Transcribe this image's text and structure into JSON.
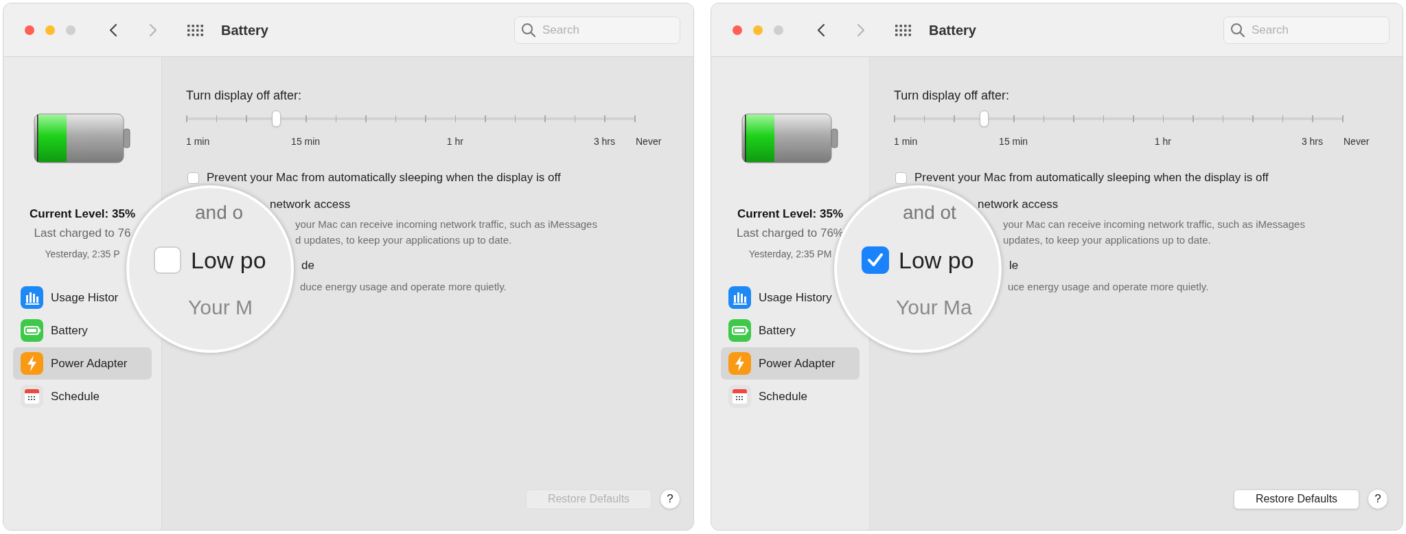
{
  "panels": [
    {
      "window": {
        "title": "Battery"
      },
      "search": {
        "placeholder": "Search"
      },
      "sidebar": {
        "current_level": "Current Level: 35%",
        "last_charged": "Last charged to 76",
        "last_charged_time": "Yesterday, 2:35 P",
        "items": [
          {
            "label": "Usage Histor",
            "kind": "usage",
            "selected": false
          },
          {
            "label": "Battery",
            "kind": "battery",
            "selected": false
          },
          {
            "label": "Power Adapter",
            "kind": "power",
            "selected": true
          },
          {
            "label": "Schedule",
            "kind": "schedule",
            "selected": false
          }
        ]
      },
      "display_off": {
        "label": "Turn display off after:",
        "slider": {
          "level": 0.2,
          "labels": [
            "1 min",
            "15 min",
            "1 hr",
            "3 hrs",
            "Never"
          ]
        }
      },
      "prevent_sleep": {
        "checked": false,
        "label": "Prevent your Mac from automatically sleeping when the display is off"
      },
      "network_fragment": "network access",
      "network_desc": [
        "your Mac can receive incoming network traffic, such as iMessages",
        "d updates, to keep your applications up to date."
      ],
      "low_power_fragment": "de",
      "low_power_desc_fragment": "duce energy usage and operate more quietly.",
      "magnifier": {
        "line_1": "and o",
        "checkbox": {
          "checked": false
        },
        "label": "Low po",
        "line_3": "Your M"
      },
      "restore_defaults": {
        "label": "Restore Defaults",
        "disabled": true
      },
      "help_button": "?"
    },
    {
      "window": {
        "title": "Battery"
      },
      "search": {
        "placeholder": "Search"
      },
      "sidebar": {
        "current_level": "Current Level: 35%",
        "last_charged": "Last charged to 76%",
        "last_charged_time": "Yesterday, 2:35 PM",
        "items": [
          {
            "label": "Usage History",
            "kind": "usage",
            "selected": false
          },
          {
            "label": "Battery",
            "kind": "battery",
            "selected": false
          },
          {
            "label": "Power Adapter",
            "kind": "power",
            "selected": true
          },
          {
            "label": "Schedule",
            "kind": "schedule",
            "selected": false
          }
        ]
      },
      "display_off": {
        "label": "Turn display off after:",
        "slider": {
          "level": 0.2,
          "labels": [
            "1 min",
            "15 min",
            "1 hr",
            "3 hrs",
            "Never"
          ]
        }
      },
      "prevent_sleep": {
        "checked": false,
        "label": "Prevent your Mac from automatically sleeping when the display is off"
      },
      "network_fragment": "network access",
      "network_desc": [
        "your Mac can receive incoming network traffic, such as iMessages",
        "updates, to keep your applications up to date."
      ],
      "low_power_fragment": "le",
      "low_power_desc_fragment": "uce energy usage and operate more quietly.",
      "magnifier": {
        "line_1": "and ot",
        "checkbox": {
          "checked": true
        },
        "label": "Low po",
        "line_3": "Your Ma"
      },
      "restore_defaults": {
        "label": "Restore Defaults",
        "disabled": false
      },
      "help_button": "?"
    }
  ]
}
